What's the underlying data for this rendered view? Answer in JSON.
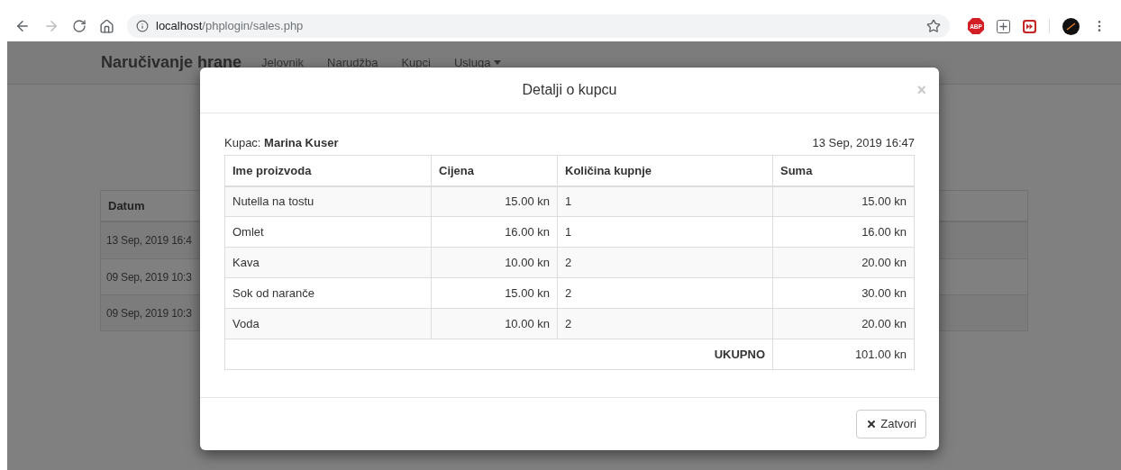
{
  "browser": {
    "url_host": "localhost",
    "url_path": "/phplogin/sales.php",
    "forward_disabled": true,
    "extension_label": "ABP"
  },
  "navbar": {
    "brand": "Naručivanje hrane",
    "items": [
      {
        "label": "Jelovnik",
        "dropdown": false
      },
      {
        "label": "Narudžba",
        "dropdown": false
      },
      {
        "label": "Kupci",
        "dropdown": false
      },
      {
        "label": "Usluga",
        "dropdown": true
      }
    ]
  },
  "background_table": {
    "header": "Datum",
    "rows": [
      "13 Sep, 2019 16:4",
      "09 Sep, 2019 10:3",
      "09 Sep, 2019 10:3"
    ]
  },
  "modal": {
    "title": "Detalji o kupcu",
    "close": "×",
    "customer_label": "Kupac:",
    "customer_name": "Marina Kuser",
    "date": "13 Sep, 2019 16:47",
    "columns": [
      "Ime proizvoda",
      "Cijena",
      "Količina kupnje",
      "Suma"
    ],
    "rows": [
      {
        "product": "Nutella na tostu",
        "price": "15.00 kn",
        "quantity": "1",
        "sum": "15.00 kn"
      },
      {
        "product": "Omlet",
        "price": "16.00 kn",
        "quantity": "1",
        "sum": "16.00 kn"
      },
      {
        "product": "Kava",
        "price": "10.00 kn",
        "quantity": "2",
        "sum": "20.00 kn"
      },
      {
        "product": "Sok od naranče",
        "price": "15.00 kn",
        "quantity": "2",
        "sum": "30.00 kn"
      },
      {
        "product": "Voda",
        "price": "10.00 kn",
        "quantity": "2",
        "sum": "20.00 kn"
      }
    ],
    "total_label": "UKUPNO",
    "total": "101.00 kn",
    "close_button": "Zatvori"
  }
}
